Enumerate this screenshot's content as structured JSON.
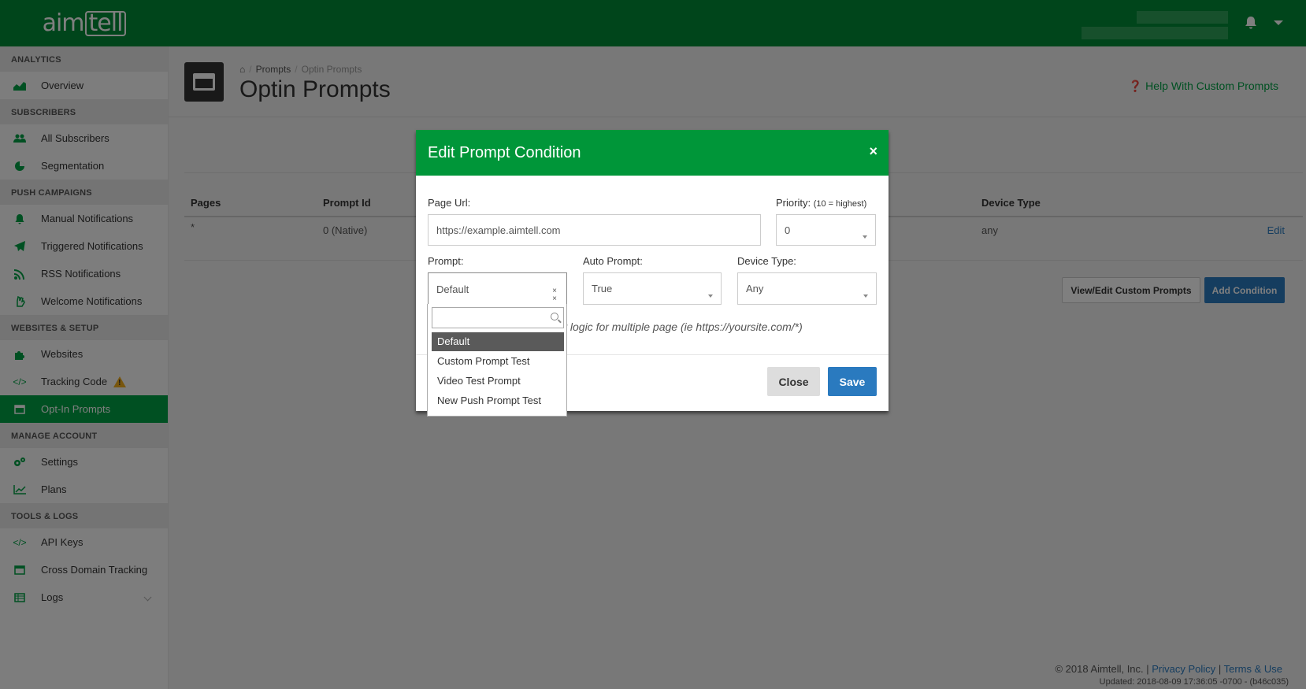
{
  "brand": {
    "logo_text_a": "aim",
    "logo_text_b": "tell"
  },
  "sidebar": {
    "sections": [
      {
        "title": "ANALYTICS",
        "items": [
          {
            "label": "Overview",
            "icon": "area-chart-icon"
          }
        ]
      },
      {
        "title": "SUBSCRIBERS",
        "items": [
          {
            "label": "All Subscribers",
            "icon": "users-icon"
          },
          {
            "label": "Segmentation",
            "icon": "pie-chart-icon"
          }
        ]
      },
      {
        "title": "PUSH CAMPAIGNS",
        "items": [
          {
            "label": "Manual Notifications",
            "icon": "bell-icon"
          },
          {
            "label": "Triggered Notifications",
            "icon": "paper-plane-icon"
          },
          {
            "label": "RSS Notifications",
            "icon": "rss-icon"
          },
          {
            "label": "Welcome Notifications",
            "icon": "hand-wave-icon"
          }
        ]
      },
      {
        "title": "WEBSITES & SETUP",
        "items": [
          {
            "label": "Websites",
            "icon": "puzzle-icon"
          },
          {
            "label": "Tracking Code",
            "icon": "code-icon"
          },
          {
            "label": "Opt-In Prompts",
            "icon": "window-icon"
          }
        ]
      },
      {
        "title": "MANAGE ACCOUNT",
        "items": [
          {
            "label": "Settings",
            "icon": "gears-icon"
          },
          {
            "label": "Plans",
            "icon": "line-chart-icon"
          }
        ]
      },
      {
        "title": "TOOLS & LOGS",
        "items": [
          {
            "label": "API Keys",
            "icon": "code-icon"
          },
          {
            "label": "Cross Domain Tracking",
            "icon": "window-icon"
          },
          {
            "label": "Logs",
            "icon": "table-icon"
          }
        ]
      }
    ]
  },
  "page": {
    "breadcrumb": {
      "prompts": "Prompts",
      "current": "Optin Prompts"
    },
    "title": "Optin Prompts",
    "help_link": "Help With Custom Prompts"
  },
  "table": {
    "headers": {
      "pages": "Pages",
      "prompt_id": "Prompt Id",
      "device_type": "Device Type"
    },
    "row": {
      "pages": "*",
      "prompt_id": "0 (Native)",
      "device_type": "any",
      "action": "Edit"
    }
  },
  "actions": {
    "view_edit": "View/Edit Custom Prompts",
    "add_condition": "Add Condition"
  },
  "footer": {
    "copyright": "© 2018 Aimtell, Inc. |",
    "privacy": "Privacy Policy",
    "sep": "|",
    "terms": "Terms & Use",
    "updated": "Updated: 2018-08-09 17:36:05 -0700 - (b46c035)"
  },
  "modal": {
    "title": "Edit Prompt Condition",
    "close_glyph": "×",
    "page_url_label": "Page Url:",
    "page_url_value": "https://example.aimtell.com",
    "priority_label": "Priority:",
    "priority_hint": "(10 = highest)",
    "priority_value": "0",
    "prompt_label": "Prompt:",
    "prompt_value": "Default",
    "auto_prompt_label": "Auto Prompt:",
    "auto_prompt_value": "True",
    "device_type_label": "Device Type:",
    "device_type_value": "Any",
    "hint_text": "y logic for multiple page (ie https://yoursite.com/*)",
    "close_button": "Close",
    "save_button": "Save",
    "prompt_options": [
      "Default",
      "Custom Prompt Test",
      "Video Test Prompt",
      "New Push Prompt Test"
    ],
    "highlighted_option": "Default"
  },
  "colors": {
    "brand_green": "#008a37",
    "active_green": "#00a044",
    "link_blue": "#2a7abf",
    "warning": "#f0ad1c"
  }
}
